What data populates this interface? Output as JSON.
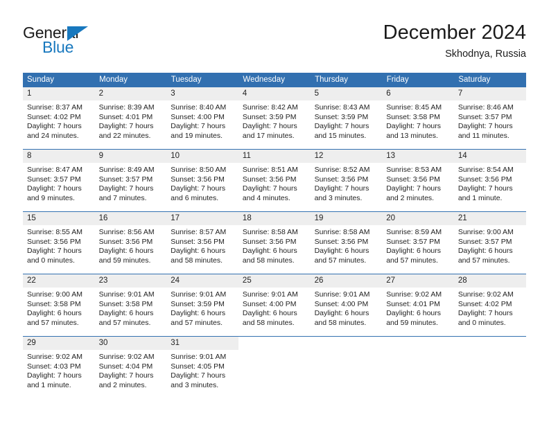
{
  "logo": {
    "word_top": "General",
    "word_bottom": "Blue",
    "triangle_color": "#1878be",
    "text_color": "#1b1b1b",
    "icon": "general-blue-logo"
  },
  "header": {
    "title": "December 2024",
    "location": "Skhodnya, Russia"
  },
  "colors": {
    "header_blue": "#3270b0",
    "daynum_band": "#eeeeee",
    "text": "#222222",
    "page_bg": "#ffffff"
  },
  "weekdays": [
    "Sunday",
    "Monday",
    "Tuesday",
    "Wednesday",
    "Thursday",
    "Friday",
    "Saturday"
  ],
  "weeks": [
    [
      {
        "day": "1",
        "sunrise": "Sunrise: 8:37 AM",
        "sunset": "Sunset: 4:02 PM",
        "daylight1": "Daylight: 7 hours",
        "daylight2": "and 24 minutes."
      },
      {
        "day": "2",
        "sunrise": "Sunrise: 8:39 AM",
        "sunset": "Sunset: 4:01 PM",
        "daylight1": "Daylight: 7 hours",
        "daylight2": "and 22 minutes."
      },
      {
        "day": "3",
        "sunrise": "Sunrise: 8:40 AM",
        "sunset": "Sunset: 4:00 PM",
        "daylight1": "Daylight: 7 hours",
        "daylight2": "and 19 minutes."
      },
      {
        "day": "4",
        "sunrise": "Sunrise: 8:42 AM",
        "sunset": "Sunset: 3:59 PM",
        "daylight1": "Daylight: 7 hours",
        "daylight2": "and 17 minutes."
      },
      {
        "day": "5",
        "sunrise": "Sunrise: 8:43 AM",
        "sunset": "Sunset: 3:59 PM",
        "daylight1": "Daylight: 7 hours",
        "daylight2": "and 15 minutes."
      },
      {
        "day": "6",
        "sunrise": "Sunrise: 8:45 AM",
        "sunset": "Sunset: 3:58 PM",
        "daylight1": "Daylight: 7 hours",
        "daylight2": "and 13 minutes."
      },
      {
        "day": "7",
        "sunrise": "Sunrise: 8:46 AM",
        "sunset": "Sunset: 3:57 PM",
        "daylight1": "Daylight: 7 hours",
        "daylight2": "and 11 minutes."
      }
    ],
    [
      {
        "day": "8",
        "sunrise": "Sunrise: 8:47 AM",
        "sunset": "Sunset: 3:57 PM",
        "daylight1": "Daylight: 7 hours",
        "daylight2": "and 9 minutes."
      },
      {
        "day": "9",
        "sunrise": "Sunrise: 8:49 AM",
        "sunset": "Sunset: 3:57 PM",
        "daylight1": "Daylight: 7 hours",
        "daylight2": "and 7 minutes."
      },
      {
        "day": "10",
        "sunrise": "Sunrise: 8:50 AM",
        "sunset": "Sunset: 3:56 PM",
        "daylight1": "Daylight: 7 hours",
        "daylight2": "and 6 minutes."
      },
      {
        "day": "11",
        "sunrise": "Sunrise: 8:51 AM",
        "sunset": "Sunset: 3:56 PM",
        "daylight1": "Daylight: 7 hours",
        "daylight2": "and 4 minutes."
      },
      {
        "day": "12",
        "sunrise": "Sunrise: 8:52 AM",
        "sunset": "Sunset: 3:56 PM",
        "daylight1": "Daylight: 7 hours",
        "daylight2": "and 3 minutes."
      },
      {
        "day": "13",
        "sunrise": "Sunrise: 8:53 AM",
        "sunset": "Sunset: 3:56 PM",
        "daylight1": "Daylight: 7 hours",
        "daylight2": "and 2 minutes."
      },
      {
        "day": "14",
        "sunrise": "Sunrise: 8:54 AM",
        "sunset": "Sunset: 3:56 PM",
        "daylight1": "Daylight: 7 hours",
        "daylight2": "and 1 minute."
      }
    ],
    [
      {
        "day": "15",
        "sunrise": "Sunrise: 8:55 AM",
        "sunset": "Sunset: 3:56 PM",
        "daylight1": "Daylight: 7 hours",
        "daylight2": "and 0 minutes."
      },
      {
        "day": "16",
        "sunrise": "Sunrise: 8:56 AM",
        "sunset": "Sunset: 3:56 PM",
        "daylight1": "Daylight: 6 hours",
        "daylight2": "and 59 minutes."
      },
      {
        "day": "17",
        "sunrise": "Sunrise: 8:57 AM",
        "sunset": "Sunset: 3:56 PM",
        "daylight1": "Daylight: 6 hours",
        "daylight2": "and 58 minutes."
      },
      {
        "day": "18",
        "sunrise": "Sunrise: 8:58 AM",
        "sunset": "Sunset: 3:56 PM",
        "daylight1": "Daylight: 6 hours",
        "daylight2": "and 58 minutes."
      },
      {
        "day": "19",
        "sunrise": "Sunrise: 8:58 AM",
        "sunset": "Sunset: 3:56 PM",
        "daylight1": "Daylight: 6 hours",
        "daylight2": "and 57 minutes."
      },
      {
        "day": "20",
        "sunrise": "Sunrise: 8:59 AM",
        "sunset": "Sunset: 3:57 PM",
        "daylight1": "Daylight: 6 hours",
        "daylight2": "and 57 minutes."
      },
      {
        "day": "21",
        "sunrise": "Sunrise: 9:00 AM",
        "sunset": "Sunset: 3:57 PM",
        "daylight1": "Daylight: 6 hours",
        "daylight2": "and 57 minutes."
      }
    ],
    [
      {
        "day": "22",
        "sunrise": "Sunrise: 9:00 AM",
        "sunset": "Sunset: 3:58 PM",
        "daylight1": "Daylight: 6 hours",
        "daylight2": "and 57 minutes."
      },
      {
        "day": "23",
        "sunrise": "Sunrise: 9:01 AM",
        "sunset": "Sunset: 3:58 PM",
        "daylight1": "Daylight: 6 hours",
        "daylight2": "and 57 minutes."
      },
      {
        "day": "24",
        "sunrise": "Sunrise: 9:01 AM",
        "sunset": "Sunset: 3:59 PM",
        "daylight1": "Daylight: 6 hours",
        "daylight2": "and 57 minutes."
      },
      {
        "day": "25",
        "sunrise": "Sunrise: 9:01 AM",
        "sunset": "Sunset: 4:00 PM",
        "daylight1": "Daylight: 6 hours",
        "daylight2": "and 58 minutes."
      },
      {
        "day": "26",
        "sunrise": "Sunrise: 9:01 AM",
        "sunset": "Sunset: 4:00 PM",
        "daylight1": "Daylight: 6 hours",
        "daylight2": "and 58 minutes."
      },
      {
        "day": "27",
        "sunrise": "Sunrise: 9:02 AM",
        "sunset": "Sunset: 4:01 PM",
        "daylight1": "Daylight: 6 hours",
        "daylight2": "and 59 minutes."
      },
      {
        "day": "28",
        "sunrise": "Sunrise: 9:02 AM",
        "sunset": "Sunset: 4:02 PM",
        "daylight1": "Daylight: 7 hours",
        "daylight2": "and 0 minutes."
      }
    ],
    [
      {
        "day": "29",
        "sunrise": "Sunrise: 9:02 AM",
        "sunset": "Sunset: 4:03 PM",
        "daylight1": "Daylight: 7 hours",
        "daylight2": "and 1 minute."
      },
      {
        "day": "30",
        "sunrise": "Sunrise: 9:02 AM",
        "sunset": "Sunset: 4:04 PM",
        "daylight1": "Daylight: 7 hours",
        "daylight2": "and 2 minutes."
      },
      {
        "day": "31",
        "sunrise": "Sunrise: 9:01 AM",
        "sunset": "Sunset: 4:05 PM",
        "daylight1": "Daylight: 7 hours",
        "daylight2": "and 3 minutes."
      },
      {
        "day": "",
        "sunrise": "",
        "sunset": "",
        "daylight1": "",
        "daylight2": ""
      },
      {
        "day": "",
        "sunrise": "",
        "sunset": "",
        "daylight1": "",
        "daylight2": ""
      },
      {
        "day": "",
        "sunrise": "",
        "sunset": "",
        "daylight1": "",
        "daylight2": ""
      },
      {
        "day": "",
        "sunrise": "",
        "sunset": "",
        "daylight1": "",
        "daylight2": ""
      }
    ]
  ]
}
